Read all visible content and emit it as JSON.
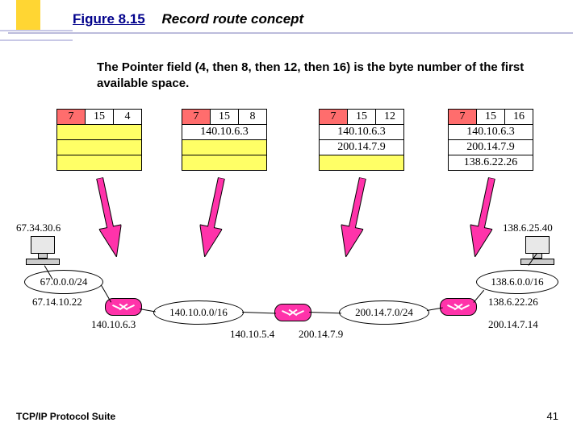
{
  "figure_label": "Figure 8.15",
  "figure_title": "Record route concept",
  "caption": "The Pointer field (4, then 8, then 12, then 16) is the byte number of the first available space.",
  "tables": [
    {
      "hdr": [
        "7",
        "15",
        "4"
      ],
      "rows": [
        "",
        "",
        ""
      ]
    },
    {
      "hdr": [
        "7",
        "15",
        "8"
      ],
      "rows": [
        "140.10.6.3",
        "",
        ""
      ]
    },
    {
      "hdr": [
        "7",
        "15",
        "12"
      ],
      "rows": [
        "140.10.6.3",
        "200.14.7.9",
        ""
      ]
    },
    {
      "hdr": [
        "7",
        "15",
        "16"
      ],
      "rows": [
        "140.10.6.3",
        "200.14.7.9",
        "138.6.22.26"
      ]
    }
  ],
  "hosts": {
    "left_ip": "67.34.30.6",
    "right_ip": "138.6.25.40"
  },
  "clouds": {
    "c1": "67.0.0.0/24",
    "c2": "140.10.0.0/16",
    "c3": "200.14.7.0/24",
    "c4": "138.6.0.0/16"
  },
  "iface": {
    "r1_left": "67.14.10.22",
    "r1_right": "140.10.6.3",
    "r2_left": "140.10.5.4",
    "r2_right": "200.14.7.9",
    "r3_left": "200.14.7.14",
    "r3_right": "138.6.22.26"
  },
  "footer_left": "TCP/IP Protocol Suite",
  "footer_right": "41"
}
